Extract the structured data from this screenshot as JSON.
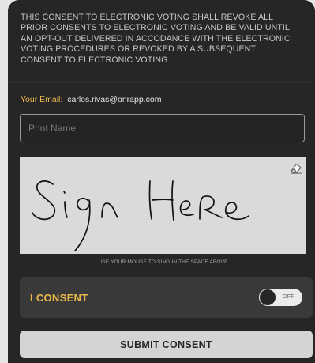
{
  "consent": {
    "text": "THIS CONSENT TO ELECTRONIC VOTING SHALL REVOKE ALL\nPRIOR CONSENTS TO ELECTRONIC VOTING AND BE VALID UNTIL\nAN OPT-OUT DELIVERED IN ACCODANCE WITH THE ELECTRONIC\nVOTING PROCEDURES OR REVOKED BY A SUBSEQUENT\nCONSENT TO ELECTRONIC VOTING."
  },
  "email": {
    "label": "Your Email:",
    "value": "carlos.rivas@onrapp.com"
  },
  "name_field": {
    "placeholder": "Print Name",
    "value": ""
  },
  "signature": {
    "hint": "USE YOUR MOUSE TO SING IN THE SPACE ABOVE",
    "eraser_icon": "eraser-icon"
  },
  "consent_toggle": {
    "label": "I CONSENT",
    "state": "OFF"
  },
  "submit": {
    "label": "SUBMIT CONSENT"
  },
  "colors": {
    "background": "#262626",
    "accent": "#e9b84a",
    "signature_pad": "#dadada",
    "button": "#d4d4d4"
  }
}
